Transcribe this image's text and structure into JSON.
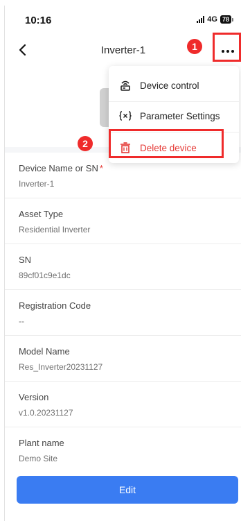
{
  "status_bar": {
    "time": "10:16",
    "network": "4G",
    "battery": "78"
  },
  "nav": {
    "title": "Inverter-1"
  },
  "menu": {
    "items": [
      {
        "label": "Device control",
        "icon": "router-icon"
      },
      {
        "label": "Parameter Settings",
        "icon": "variable-icon"
      },
      {
        "label": "Delete device",
        "icon": "trash-icon"
      }
    ]
  },
  "fields": [
    {
      "label": "Device Name or SN",
      "value": "Inverter-1"
    },
    {
      "label": "Asset Type",
      "value": "Residential Inverter"
    },
    {
      "label": "SN",
      "value": "89cf01c9e1dc"
    },
    {
      "label": "Registration Code",
      "value": "--"
    },
    {
      "label": "Model Name",
      "value": "Res_Inverter20231127"
    },
    {
      "label": "Version",
      "value": "v1.0.20231127"
    },
    {
      "label": "Plant name",
      "value": "Demo Site"
    }
  ],
  "required_mark": "*",
  "footer": {
    "edit_label": "Edit"
  },
  "annotations": {
    "badge_1": "1",
    "badge_2": "2"
  },
  "colors": {
    "accent": "#3a7cf2",
    "danger": "#e53935",
    "annotation": "#ef2b2b"
  }
}
